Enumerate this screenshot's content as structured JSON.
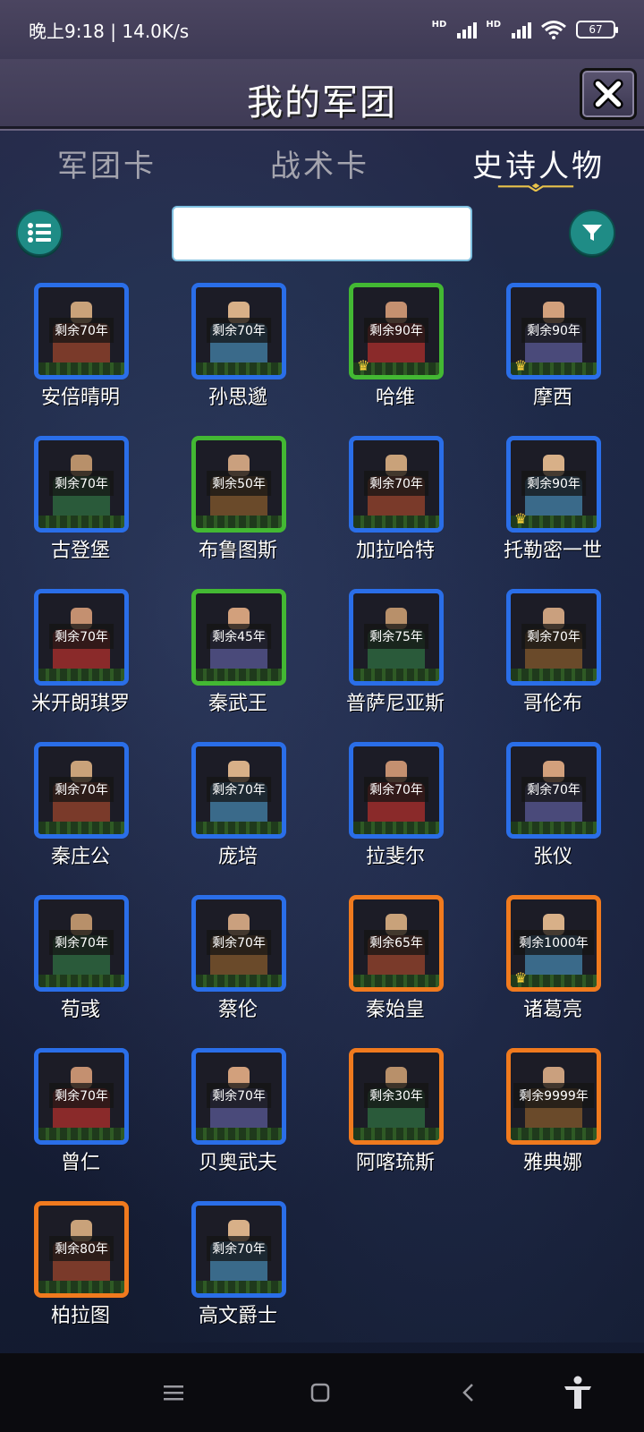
{
  "status_bar": {
    "time_speed": "晚上9:18 | 14.0K/s",
    "hd1": "HD",
    "hd2": "HD",
    "battery": "67"
  },
  "header": {
    "title": "我的军团"
  },
  "tabs": [
    {
      "label": "军团卡",
      "active": false
    },
    {
      "label": "战术卡",
      "active": false
    },
    {
      "label": "史诗人物",
      "active": true
    }
  ],
  "toolbar": {
    "menu_icon": "list-icon",
    "filter_icon": "filter-icon",
    "search_value": ""
  },
  "characters": [
    {
      "name": "安倍晴明",
      "remain": "剩余70年",
      "rarity": "blue",
      "crown": false
    },
    {
      "name": "孙思邈",
      "remain": "剩余70年",
      "rarity": "blue",
      "crown": false
    },
    {
      "name": "哈维",
      "remain": "剩余90年",
      "rarity": "green",
      "crown": true
    },
    {
      "name": "摩西",
      "remain": "剩余90年",
      "rarity": "blue",
      "crown": true
    },
    {
      "name": "古登堡",
      "remain": "剩余70年",
      "rarity": "blue",
      "crown": false
    },
    {
      "name": "布鲁图斯",
      "remain": "剩余50年",
      "rarity": "green",
      "crown": false
    },
    {
      "name": "加拉哈特",
      "remain": "剩余70年",
      "rarity": "blue",
      "crown": false
    },
    {
      "name": "托勒密一世",
      "remain": "剩余90年",
      "rarity": "blue",
      "crown": true
    },
    {
      "name": "米开朗琪罗",
      "remain": "剩余70年",
      "rarity": "blue",
      "crown": false
    },
    {
      "name": "秦武王",
      "remain": "剩余45年",
      "rarity": "green",
      "crown": false
    },
    {
      "name": "普萨尼亚斯",
      "remain": "剩余75年",
      "rarity": "blue",
      "crown": false
    },
    {
      "name": "哥伦布",
      "remain": "剩余70年",
      "rarity": "blue",
      "crown": false
    },
    {
      "name": "秦庄公",
      "remain": "剩余70年",
      "rarity": "blue",
      "crown": false
    },
    {
      "name": "庞培",
      "remain": "剩余70年",
      "rarity": "blue",
      "crown": false
    },
    {
      "name": "拉斐尔",
      "remain": "剩余70年",
      "rarity": "blue",
      "crown": false
    },
    {
      "name": "张仪",
      "remain": "剩余70年",
      "rarity": "blue",
      "crown": false
    },
    {
      "name": "荀彧",
      "remain": "剩余70年",
      "rarity": "blue",
      "crown": false
    },
    {
      "name": "蔡伦",
      "remain": "剩余70年",
      "rarity": "blue",
      "crown": false
    },
    {
      "name": "秦始皇",
      "remain": "剩余65年",
      "rarity": "orange",
      "crown": false
    },
    {
      "name": "诸葛亮",
      "remain": "剩余1000年",
      "rarity": "orange",
      "crown": true
    },
    {
      "name": "曾仁",
      "remain": "剩余70年",
      "rarity": "blue",
      "crown": false
    },
    {
      "name": "贝奥武夫",
      "remain": "剩余70年",
      "rarity": "blue",
      "crown": false
    },
    {
      "name": "阿喀琉斯",
      "remain": "剩余30年",
      "rarity": "orange",
      "crown": false
    },
    {
      "name": "雅典娜",
      "remain": "剩余9999年",
      "rarity": "orange",
      "crown": false
    },
    {
      "name": "柏拉图",
      "remain": "剩余80年",
      "rarity": "orange",
      "crown": false
    },
    {
      "name": "高文爵士",
      "remain": "剩余70年",
      "rarity": "blue",
      "crown": false
    }
  ],
  "nav_bar": {
    "menu_icon": "hamburger-icon",
    "home_icon": "square-home-icon",
    "back_icon": "back-chevron-icon",
    "accessibility_icon": "accessibility-icon"
  }
}
